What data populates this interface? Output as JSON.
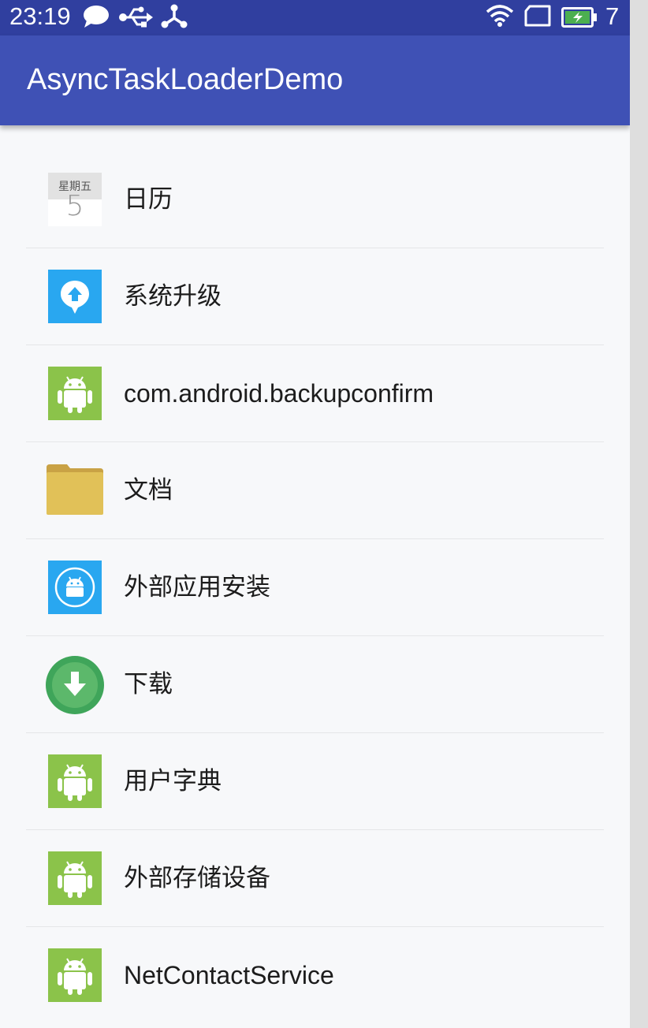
{
  "status_bar": {
    "time": "23:19",
    "battery_level": "7",
    "icons": [
      "chat-bubble-icon",
      "usb-icon",
      "share-node-icon",
      "wifi-icon",
      "sim-card-icon",
      "battery-charging-icon"
    ]
  },
  "app_bar": {
    "title": "AsyncTaskLoaderDemo",
    "color": "#3f51b5",
    "status_color": "#303f9f"
  },
  "calendar_icon": {
    "weekday": "星期五",
    "day": "5"
  },
  "apps": [
    {
      "label": "日历",
      "icon": "calendar-icon"
    },
    {
      "label": "系统升级",
      "icon": "system-update-icon"
    },
    {
      "label": "com.android.backupconfirm",
      "icon": "android-icon"
    },
    {
      "label": "文档",
      "icon": "folder-icon"
    },
    {
      "label": "外部应用安装",
      "icon": "package-installer-icon"
    },
    {
      "label": "下载",
      "icon": "download-icon"
    },
    {
      "label": "用户字典",
      "icon": "android-icon"
    },
    {
      "label": "外部存储设备",
      "icon": "android-icon"
    },
    {
      "label": "NetContactService",
      "icon": "android-icon"
    }
  ]
}
